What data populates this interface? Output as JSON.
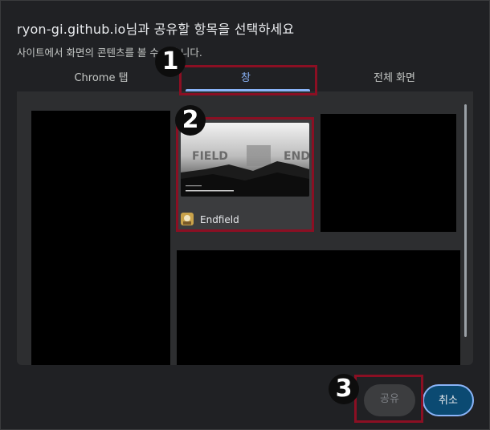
{
  "dialog": {
    "title": "ryon-gi.github.io님과 공유할 항목을 선택하세요",
    "subtitle": "사이트에서 화면의 콘텐츠를 볼 수 있습니다."
  },
  "tabs": [
    {
      "label": "Chrome 탭",
      "selected": false
    },
    {
      "label": "창",
      "selected": true
    },
    {
      "label": "전체 화면",
      "selected": false
    }
  ],
  "windows": [
    {
      "label": "Endfield",
      "icon": "endfield-app-icon",
      "selected": true
    }
  ],
  "buttons": {
    "share": "공유",
    "cancel": "취소"
  },
  "annotations": {
    "steps": [
      "1",
      "2",
      "3"
    ],
    "highlight_color": "#8b0f23"
  },
  "colors": {
    "accent": "#8ab4f8",
    "panel": "#2d2e30",
    "background": "#202124"
  }
}
